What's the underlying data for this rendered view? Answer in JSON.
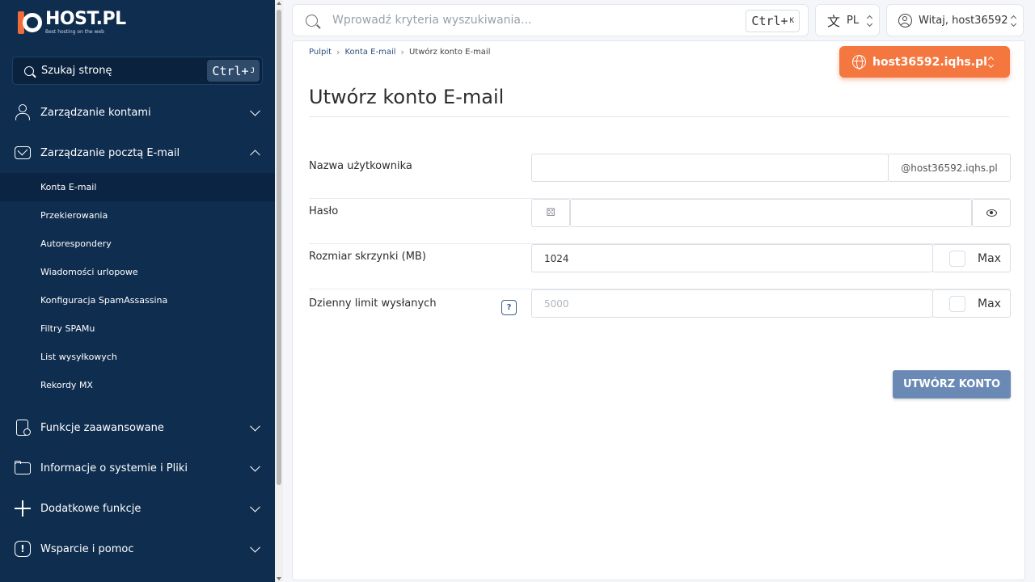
{
  "brand": {
    "name": "HOST.PL",
    "tagline": "Best hosting on the web",
    "accent": "#f26b3a",
    "sidebar_bg": "#0f2d4f"
  },
  "sidebar": {
    "search_label": "Szukaj stronę",
    "search_shortcut": "Ctrl+",
    "search_shortcut_key": "J",
    "sections": [
      {
        "label": "Zarządzanie kontami",
        "icon": "user-icon",
        "expanded": false
      },
      {
        "label": "Zarządzanie pocztą E-mail",
        "icon": "mail-icon",
        "expanded": true,
        "items": [
          "Konta E-mail",
          "Przekierowania",
          "Autorespondery",
          "Wiadomości urlopowe",
          "Konfiguracja SpamAssassina",
          "Filtry SPAMu",
          "List wysyłkowych",
          "Rekordy MX"
        ],
        "active_item": "Konta E-mail"
      },
      {
        "label": "Funkcje zaawansowane",
        "icon": "file-settings-icon",
        "expanded": false
      },
      {
        "label": "Informacje o systemie i Pliki",
        "icon": "folder-icon",
        "expanded": false
      },
      {
        "label": "Dodatkowe funkcje",
        "icon": "plus-icon",
        "expanded": false
      },
      {
        "label": "Wsparcie i pomoc",
        "icon": "alert-icon",
        "expanded": false
      }
    ]
  },
  "topbar": {
    "search_placeholder": "Wprowadź kryteria wyszukiwania...",
    "search_shortcut": "Ctrl+",
    "search_shortcut_key": "K",
    "language": "PL",
    "user_greeting": "Witaj, host36592"
  },
  "breadcrumb": [
    "Pulpit",
    "Konta E-mail",
    "Utwórz konto E-mail"
  ],
  "domain_selector": {
    "label": "host36592.iqhs.pl",
    "color": "#f4773f"
  },
  "page_title": "Utwórz konto E-mail",
  "form": {
    "username": {
      "label": "Nazwa użytkownika",
      "value": "",
      "suffix": "@host36592.iqhs.pl"
    },
    "password": {
      "label": "Hasło",
      "value": ""
    },
    "quota": {
      "label": "Rozmiar skrzynki (MB)",
      "value": "1024",
      "max_label": "Max",
      "max_checked": false
    },
    "daily_limit": {
      "label": "Dzienny limit wysłanych",
      "placeholder": "5000",
      "help": "?",
      "max_label": "Max",
      "max_checked": false
    },
    "submit_label": "UTWÓRZ KONTO",
    "submit_color": "#6a89b5"
  }
}
